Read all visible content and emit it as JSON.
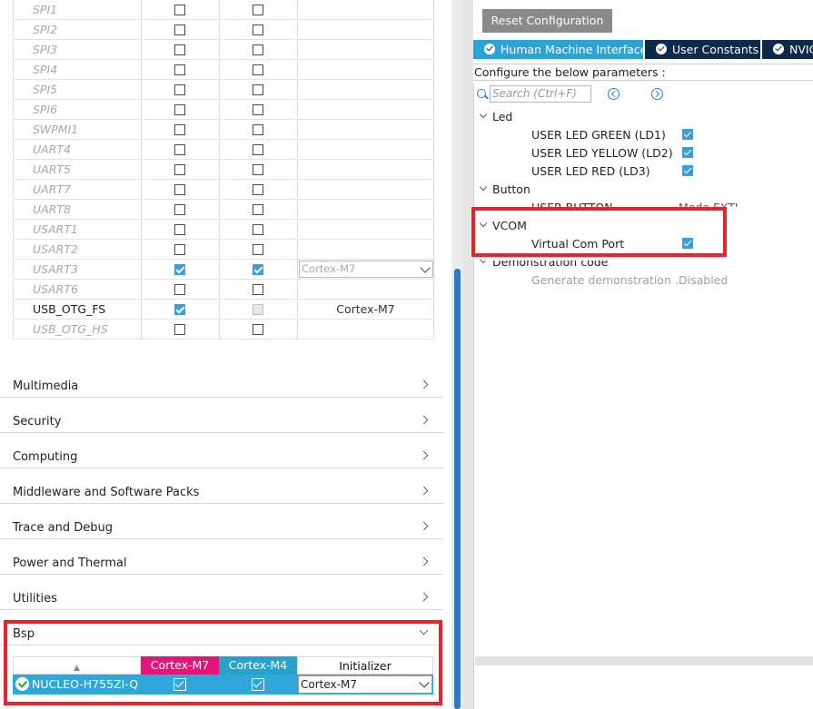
{
  "peripherals": [
    {
      "name": "SPI1",
      "active": false,
      "cb1": false,
      "cb2": false,
      "init": ""
    },
    {
      "name": "SPI2",
      "active": false,
      "cb1": false,
      "cb2": false,
      "init": ""
    },
    {
      "name": "SPI3",
      "active": false,
      "cb1": false,
      "cb2": false,
      "init": ""
    },
    {
      "name": "SPI4",
      "active": false,
      "cb1": false,
      "cb2": false,
      "init": ""
    },
    {
      "name": "SPI5",
      "active": false,
      "cb1": false,
      "cb2": false,
      "init": ""
    },
    {
      "name": "SPI6",
      "active": false,
      "cb1": false,
      "cb2": false,
      "init": ""
    },
    {
      "name": "SWPMI1",
      "active": false,
      "cb1": false,
      "cb2": false,
      "init": ""
    },
    {
      "name": "UART4",
      "active": false,
      "cb1": false,
      "cb2": false,
      "init": ""
    },
    {
      "name": "UART5",
      "active": false,
      "cb1": false,
      "cb2": false,
      "init": ""
    },
    {
      "name": "UART7",
      "active": false,
      "cb1": false,
      "cb2": false,
      "init": ""
    },
    {
      "name": "UART8",
      "active": false,
      "cb1": false,
      "cb2": false,
      "init": ""
    },
    {
      "name": "USART1",
      "active": false,
      "cb1": false,
      "cb2": false,
      "init": ""
    },
    {
      "name": "USART2",
      "active": false,
      "cb1": false,
      "cb2": false,
      "init": ""
    },
    {
      "name": "USART3",
      "active": false,
      "cb1": true,
      "cb2": true,
      "init": "Cortex-M7",
      "init_type": "select"
    },
    {
      "name": "USART6",
      "active": false,
      "cb1": false,
      "cb2": false,
      "init": ""
    },
    {
      "name": "USB_OTG_FS",
      "active": true,
      "cb1": true,
      "cb2": "disabled",
      "init": "Cortex-M7",
      "init_type": "text"
    },
    {
      "name": "USB_OTG_HS",
      "active": false,
      "cb1": false,
      "cb2": false,
      "init": ""
    }
  ],
  "categories": [
    "Multimedia",
    "Security",
    "Computing",
    "Middleware and Software Packs",
    "Trace and Debug",
    "Power and Thermal",
    "Utilities",
    "Bsp"
  ],
  "bsp": {
    "headers": {
      "col_m7": "Cortex-M7",
      "col_m4": "Cortex-M4",
      "col_init": "Initializer"
    },
    "row": {
      "name": "NUCLEO-H755ZI-Q",
      "m7": true,
      "m4": true,
      "init": "Cortex-M7"
    }
  },
  "right": {
    "reset_button": "Reset Configuration",
    "tabs": [
      "Human Machine Interface",
      "User Constants",
      "NVIC"
    ],
    "configure_label": "Configure the below parameters :",
    "search_placeholder": "Search (Ctrl+F)",
    "groups": {
      "led": "Led",
      "button": "Button",
      "vcom": "VCOM",
      "demo": "Demonstration code"
    },
    "params": {
      "led_green": "USER LED GREEN (LD1)",
      "led_yellow": "USER LED YELLOW (LD2)",
      "led_red": "USER LED RED (LD3)",
      "user_button": "USER BUTTON",
      "user_button_val": "Mode EXTI",
      "virtual_com": "Virtual Com Port",
      "gen_demo": "Generate demonstration ...",
      "gen_demo_val": "Disabled"
    }
  },
  "colors": {
    "accent_blue": "#2ca3d6",
    "highlight_red": "#e8222d",
    "cortex_m7": "#e5147a",
    "cortex_m4": "#27a3c9",
    "tab_dark": "#0c2a4a"
  }
}
